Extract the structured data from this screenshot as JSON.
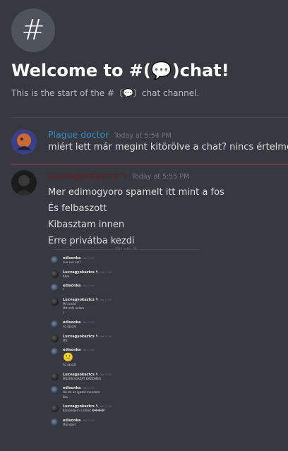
{
  "welcome": {
    "icon": "hash-icon",
    "title": "Welcome to #(💬)chat!",
    "subtitle": "This is the start of the #〔💬〕chat channel."
  },
  "messages": [
    {
      "author": "Plague doctor",
      "author_color": "#3b8bc9",
      "timestamp": "Today at 5:54 PM",
      "lines": [
        "miért lett már megint kitörölve a chat? nincs értelme"
      ]
    },
    {
      "author": "Luxvagyokaztcs ϟ",
      "author_color": "#6b1d1d",
      "timestamp": "Today at 5:55 PM",
      "lines": [
        "Mer edimogyoro spamelt itt mint a fos",
        "És felbaszott",
        "Kibasztam innen",
        "Erre privátba kezdi"
      ]
    }
  ],
  "embedded_screenshot": {
    "separator": "2020. márc. 20.",
    "messages": [
      {
        "author": "edisonka",
        "timestamp": "Ma 17:00",
        "avatar": "a",
        "lines": [
          "Lux sus cel?"
        ]
      },
      {
        "author": "Luxvagyokaztcs ϟ",
        "timestamp": "Ma 17:00",
        "avatar": "b",
        "lines": [
          "Khm"
        ]
      },
      {
        "author": "edisonka",
        "timestamp": "Ma 17:00",
        "avatar": "a",
        "lines": [
          "?"
        ]
      },
      {
        "author": "Luxvagyokaztcs ϟ",
        "timestamp": "Ma 17:00",
        "avatar": "b",
        "lines": [
          "Mi csodá",
          "Mit írtál nelam",
          "?"
        ]
      },
      {
        "author": "edisonka",
        "timestamp": "Ma 17:00",
        "avatar": "a",
        "lines": [
          "Az igazat"
        ]
      },
      {
        "author": "Luxvagyokaztcs ϟ",
        "timestamp": "Ma 17:00",
        "avatar": "b",
        "lines": [
          "Mit"
        ]
      },
      {
        "author": "edisonka",
        "timestamp": "Ma 17:00",
        "avatar": "a",
        "lines": [
          "🙂",
          "Az igazat"
        ]
      },
      {
        "author": "Luxvagyokaztcs ϟ",
        "timestamp": "Ma 17:00",
        "avatar": "b",
        "lines": [
          "MILYEN IGAZAT BAZDMEG"
        ]
      },
      {
        "author": "edisonka",
        "timestamp": "Ma 17:00",
        "avatar": "a",
        "lines": [
          "Há de az igazat mondom",
          "Bro"
        ]
      },
      {
        "author": "Luxvagyokaztcs ϟ",
        "timestamp": "Ma 17:00",
        "avatar": "b",
        "lines": [
          "Kimondjam a titkot ����?"
        ]
      },
      {
        "author": "edisonka",
        "timestamp": "Ma 17:00",
        "avatar": "a",
        "lines": [
          "Mondjad"
        ]
      }
    ]
  },
  "colors": {
    "background": "#36393f",
    "new_message_line": "#f04747"
  }
}
